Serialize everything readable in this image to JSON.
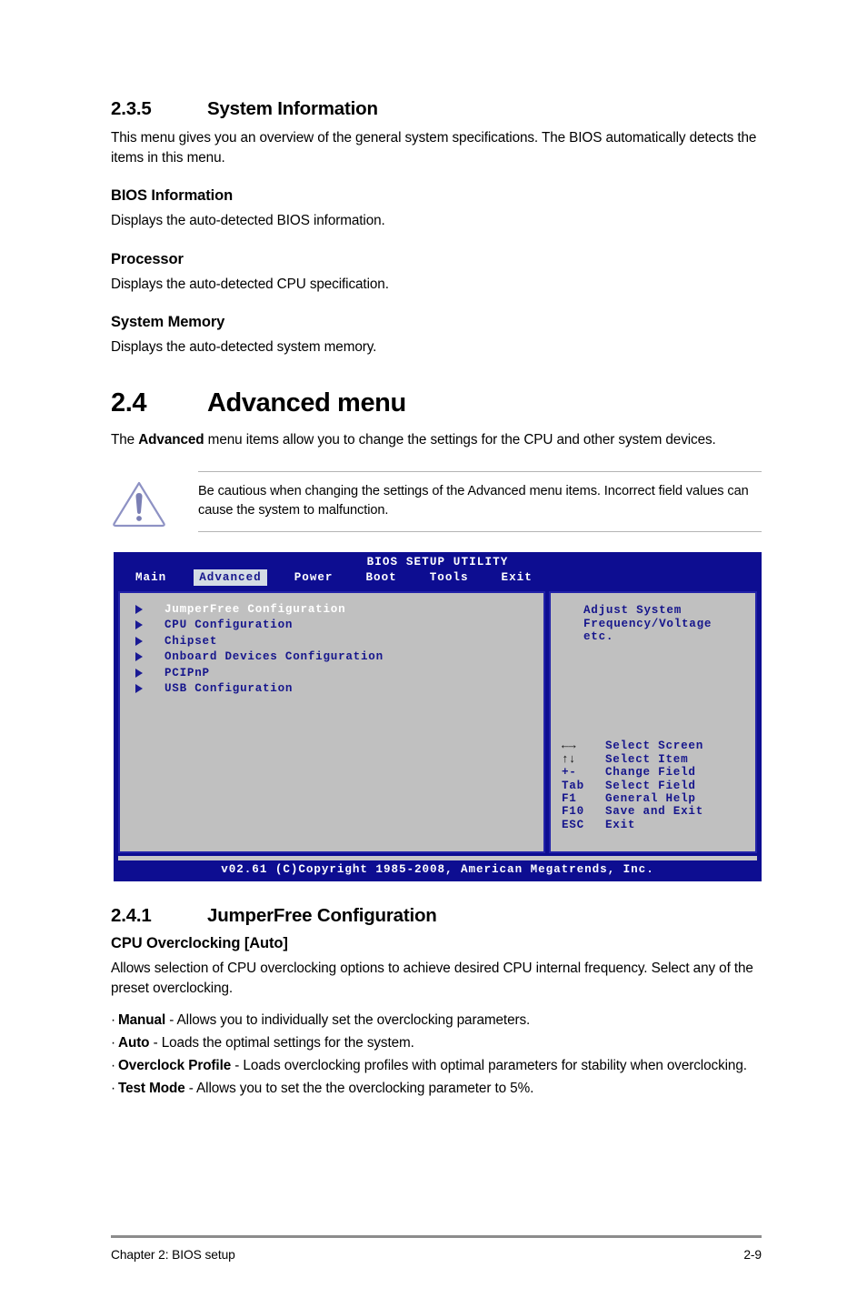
{
  "sections": {
    "system_information": {
      "number": "2.3.5",
      "title": "System Information",
      "intro": "This menu gives you an overview of the general system specifications. The BIOS automatically detects the items in this menu.",
      "subsections": [
        {
          "heading": "BIOS Information",
          "text": "Displays the auto-detected BIOS information."
        },
        {
          "heading": "Processor",
          "text": "Displays the auto-detected CPU specification."
        },
        {
          "heading": "System Memory",
          "text": "Displays the auto-detected system memory."
        }
      ]
    },
    "advanced_menu": {
      "number": "2.4",
      "title": "Advanced menu",
      "intro_pre": "The ",
      "intro_bold": "Advanced",
      "intro_post": " menu items allow you to change the settings for the CPU and other system devices.",
      "note": {
        "icon": "warning-triangle-icon",
        "text": "Be cautious when changing the settings of the Advanced menu items. Incorrect field values can cause the system to malfunction."
      }
    },
    "jumperfree": {
      "number": "2.4.1",
      "title": "JumperFree Configuration",
      "option_heading": "CPU Overclocking [Auto]",
      "option_text": "Allows selection of CPU overclocking options to achieve desired CPU internal frequency. Select any of the preset overclocking.",
      "bullets": [
        {
          "marker": "·",
          "term": "Manual",
          "desc": " - Allows you to individually set the overclocking parameters."
        },
        {
          "marker": "·",
          "term": "Auto",
          "desc": " - Loads the optimal settings for the system."
        },
        {
          "marker": "·",
          "term": "Overclock Profile",
          "desc": " - Loads overclocking profiles with optimal parameters for stability when overclocking."
        },
        {
          "marker": "·",
          "term": "Test Mode",
          "desc": " - Allows you to set the the overclocking parameter to 5%."
        }
      ]
    }
  },
  "bios_screen": {
    "title": "BIOS SETUP UTILITY",
    "tabs": [
      {
        "label": "Main",
        "active": false
      },
      {
        "label": "Advanced",
        "active": true
      },
      {
        "label": "Power",
        "active": false
      },
      {
        "label": "Boot",
        "active": false
      },
      {
        "label": "Tools",
        "active": false
      },
      {
        "label": "Exit",
        "active": false
      }
    ],
    "menu_items": [
      {
        "label": "JumperFree Configuration",
        "selected": true
      },
      {
        "label": "CPU Configuration",
        "selected": false
      },
      {
        "label": "Chipset",
        "selected": false
      },
      {
        "label": "Onboard Devices Configuration",
        "selected": false
      },
      {
        "label": "PCIPnP",
        "selected": false
      },
      {
        "label": "USB Configuration",
        "selected": false
      }
    ],
    "help_description": [
      "Adjust System",
      "Frequency/Voltage",
      "etc."
    ],
    "key_legend": [
      {
        "key": "←→",
        "glyph": true,
        "action": "Select Screen"
      },
      {
        "key": "↑↓",
        "glyph": true,
        "action": "Select Item"
      },
      {
        "key": "+-",
        "glyph": false,
        "action": "Change Field"
      },
      {
        "key": "Tab",
        "glyph": false,
        "action": "Select Field"
      },
      {
        "key": "F1",
        "glyph": false,
        "action": "General Help"
      },
      {
        "key": "F10",
        "glyph": false,
        "action": "Save and Exit"
      },
      {
        "key": "ESC",
        "glyph": false,
        "action": "Exit"
      }
    ],
    "footer": "v02.61 (C)Copyright 1985-2008, American Megatrends, Inc.",
    "colors": {
      "chrome_navy": "#0d0d91",
      "panel_gray": "#c0c0c0",
      "panel_border": "#2222a8",
      "text_blue": "#16168c",
      "active_tab_bg": "#d4dce4",
      "selected_text": "#ffffff"
    }
  },
  "page_footer": {
    "chapter": "Chapter 2: BIOS setup",
    "page_number": "2-9"
  }
}
